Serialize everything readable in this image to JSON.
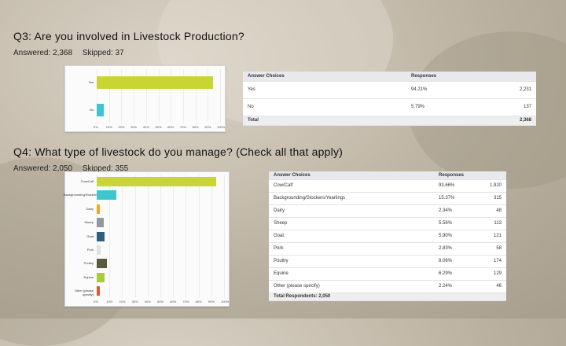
{
  "q3": {
    "title": "Q3: Are you involved in Livestock Production?",
    "answered": "Answered: 2,368",
    "skipped": "Skipped: 37",
    "chart_data": {
      "type": "bar",
      "orientation": "horizontal",
      "categories": [
        "Yes",
        "No"
      ],
      "values": [
        94.21,
        5.79
      ],
      "xlim": [
        0,
        100
      ],
      "ticks": [
        "0%",
        "10%",
        "20%",
        "30%",
        "40%",
        "50%",
        "60%",
        "70%",
        "80%",
        "90%",
        "100%"
      ],
      "colors": [
        "#c9d534",
        "#3ec6cf"
      ]
    },
    "table": {
      "headers": [
        "Answer Choices",
        "Responses",
        ""
      ],
      "rows": [
        {
          "choice": "Yes",
          "pct": "94.21%",
          "count": "2,231"
        },
        {
          "choice": "No",
          "pct": "5.79%",
          "count": "137"
        }
      ],
      "total_label": "Total",
      "total_value": "2,368"
    }
  },
  "q4": {
    "title": "Q4: What type of livestock do you manage? (Check all that apply)",
    "answered": "Answered: 2,050",
    "skipped": "Skipped: 355",
    "chart_data": {
      "type": "bar",
      "orientation": "horizontal",
      "categories": [
        "Cow/Calf",
        "Backgrounding/Stockers/Yearlings",
        "Dairy",
        "Sheep",
        "Goat",
        "Pork",
        "Poultry",
        "Equine",
        "Other (please specify)"
      ],
      "values": [
        93.66,
        15.37,
        2.34,
        5.56,
        5.9,
        2.83,
        8.06,
        6.29,
        2.24
      ],
      "xlim": [
        0,
        100
      ],
      "ticks": [
        "0%",
        "10%",
        "20%",
        "30%",
        "40%",
        "50%",
        "60%",
        "70%",
        "80%",
        "90%",
        "100%"
      ],
      "colors": [
        "#c9d534",
        "#3ec6cf",
        "#f5a623",
        "#8f9aa3",
        "#2f5f7f",
        "#e1e1e1",
        "#5a5a3c",
        "#a9cc3a",
        "#e05a2e"
      ]
    },
    "table": {
      "headers": [
        "Answer Choices",
        "Responses",
        ""
      ],
      "rows": [
        {
          "choice": "Cow/Calf",
          "pct": "93.66%",
          "count": "1,920"
        },
        {
          "choice": "Backgrounding/Stockers/Yearlings",
          "pct": "15.37%",
          "count": "315"
        },
        {
          "choice": "Dairy",
          "pct": "2.34%",
          "count": "48"
        },
        {
          "choice": "Sheep",
          "pct": "5.56%",
          "count": "113"
        },
        {
          "choice": "Goat",
          "pct": "5.90%",
          "count": "121"
        },
        {
          "choice": "Pork",
          "pct": "2.83%",
          "count": "58"
        },
        {
          "choice": "Poultry",
          "pct": "8.06%",
          "count": "174"
        },
        {
          "choice": "Equine",
          "pct": "6.29%",
          "count": "129"
        },
        {
          "choice": "Other (please specify)",
          "pct": "2.24%",
          "count": "46"
        }
      ],
      "total_label": "Total Respondents: 2,050"
    }
  }
}
